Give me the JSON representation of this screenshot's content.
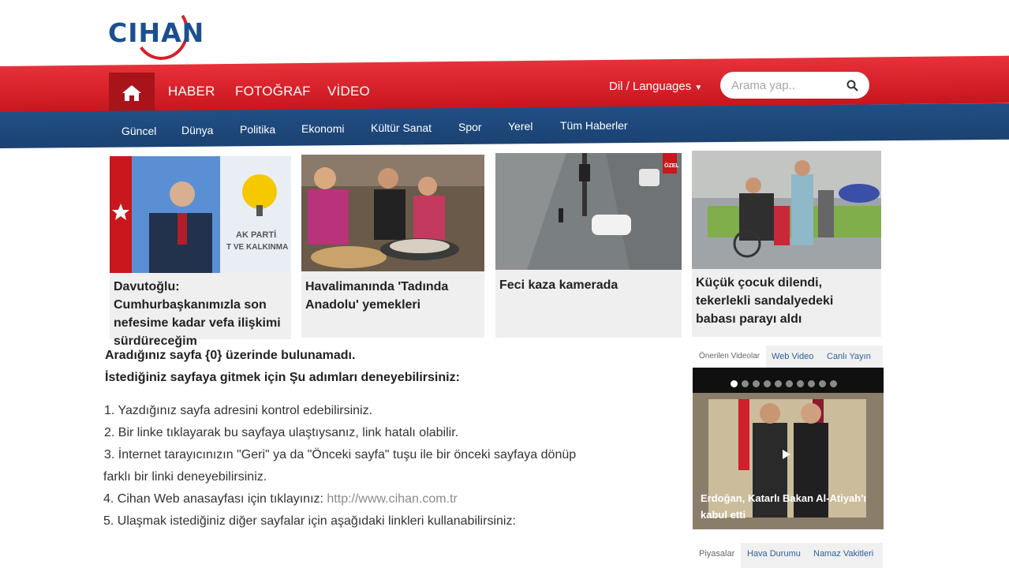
{
  "logo": {
    "text": "CIHAN"
  },
  "nav": {
    "home_icon": "home-icon",
    "items": [
      "HABER",
      "FOTOĞRAF",
      "VİDEO"
    ],
    "language": "Dil / Languages",
    "search_placeholder": "Arama yap.."
  },
  "subnav": [
    "Güncel",
    "Dünya",
    "Politika",
    "Ekonomi",
    "Kültür Sanat",
    "Spor",
    "Yerel",
    "Tüm Haberler"
  ],
  "cards": [
    {
      "title": "Davutoğlu: Cumhurbaşkanımızla son nefesime kadar vefa ilişkimi sürdüreceğim",
      "img_text": "AK PARTİ",
      "img_text2": "T VE KALKINMA"
    },
    {
      "title": "Havalimanında 'Tadında Anadolu' yemekleri"
    },
    {
      "title": "Feci kaza kamerada",
      "badge": "ÖZEL"
    },
    {
      "title": "Küçük çocuk dilendi, tekerlekli sandalyedeki babası parayı aldı"
    }
  ],
  "error": {
    "line1": "Aradığınız sayfa {0} üzerinde bulunamadı.",
    "line2": "İstediğiniz sayfaya gitmek için Şu adımları deneyebilirsiniz:",
    "steps": [
      "1. Yazdığınız sayfa adresini kontrol edebilirsiniz.",
      "2. Bir linke tıklayarak bu sayfaya ulaştıysanız, link hatalı olabilir.",
      "3. İnternet tarayıcınızın \"Geri\" ya da \"Önceki sayfa\" tuşu ile bir önceki sayfaya dönüp",
      "farklı bir linki deneyebilirsiniz.",
      "4. Cihan Web anasayfası için tıklayınız: ",
      "5. Ulaşmak istediğiniz diğer sayfalar için aşağıdaki linkleri kullanabilirsiniz:"
    ],
    "home_link": "http://www.cihan.com.tr"
  },
  "video_widget": {
    "tabs": [
      "Önerilen Videolar",
      "Web Video",
      "Canlı Yayın"
    ],
    "caption": "Erdoğan, Katarlı Bakan Al-Atiyah'ı kabul etti",
    "dot_count": 10,
    "active_dot": 0
  },
  "bottom_tabs": [
    "Piyasalar",
    "Hava Durumu",
    "Namaz Vakitleri"
  ]
}
